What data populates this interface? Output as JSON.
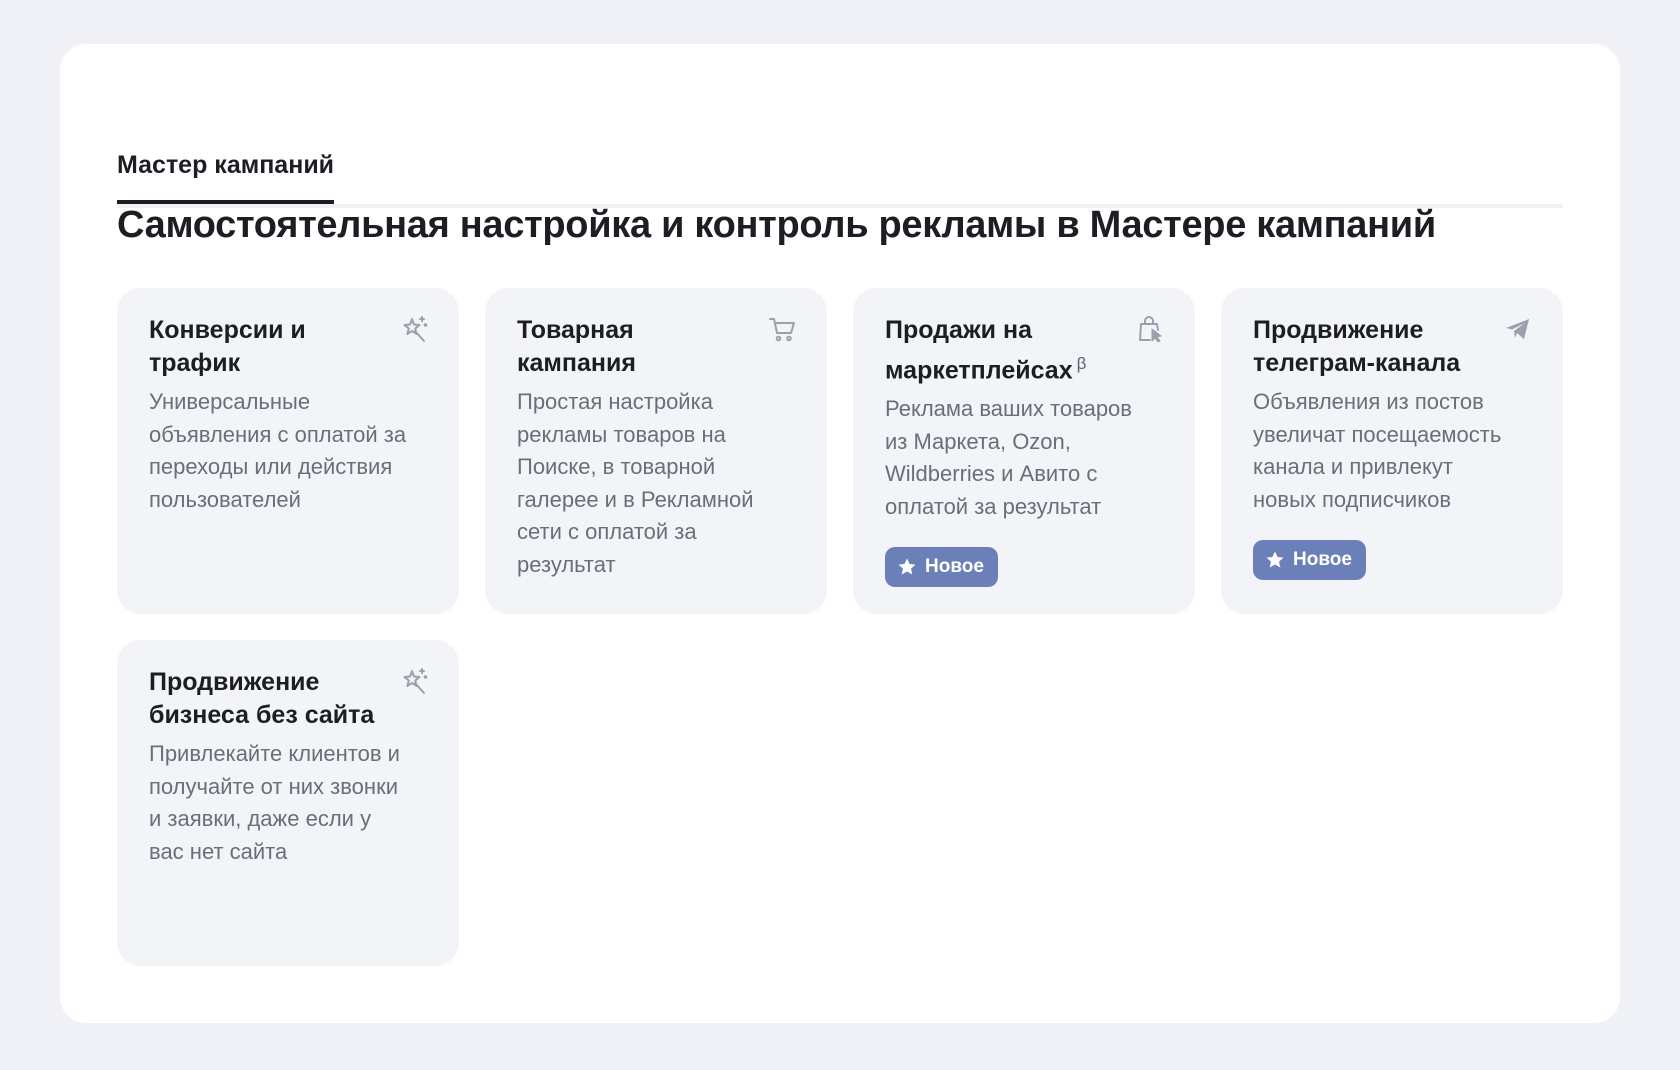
{
  "tabs": [
    {
      "label": "Мастер кампаний",
      "active": true
    }
  ],
  "page_title": "Самостоятельная настройка и контроль рекламы в Мастере кампаний",
  "cards": [
    {
      "title": "Конверсии и трафик",
      "desc": "Универсальные объявления с оплатой за переходы или действия пользователей",
      "icon": "magic-wand-icon"
    },
    {
      "title": "Товарная кампания",
      "desc": "Простая настройка рекламы товаров на Поиске, в товарной галерее и в Рекламной сети с оплатой за результат",
      "icon": "cart-icon"
    },
    {
      "title": "Продажи на маркетплейсах",
      "beta": "β",
      "desc": "Реклама ваших товаров из Маркета, Ozon, Wildberries и Авито с оплатой за результат",
      "icon": "shopping-bag-icon",
      "badge": "Новое"
    },
    {
      "title": "Продвижение телеграм-канала",
      "desc": "Объявления из постов увеличат посещаемость канала и привлекут новых подписчиков",
      "icon": "telegram-plane-icon",
      "badge": "Новое"
    },
    {
      "title": "Продвижение бизнеса без сайта",
      "desc": "Привлекайте клиентов и получайте от них звонки и заявки, даже если у вас нет сайта",
      "icon": "magic-wand-icon"
    }
  ],
  "colors": {
    "background": "#eff1f6",
    "card": "#f3f4f8",
    "badge": "#6b80b8",
    "text": "#1c1e24",
    "muted": "#6b6e7a"
  }
}
